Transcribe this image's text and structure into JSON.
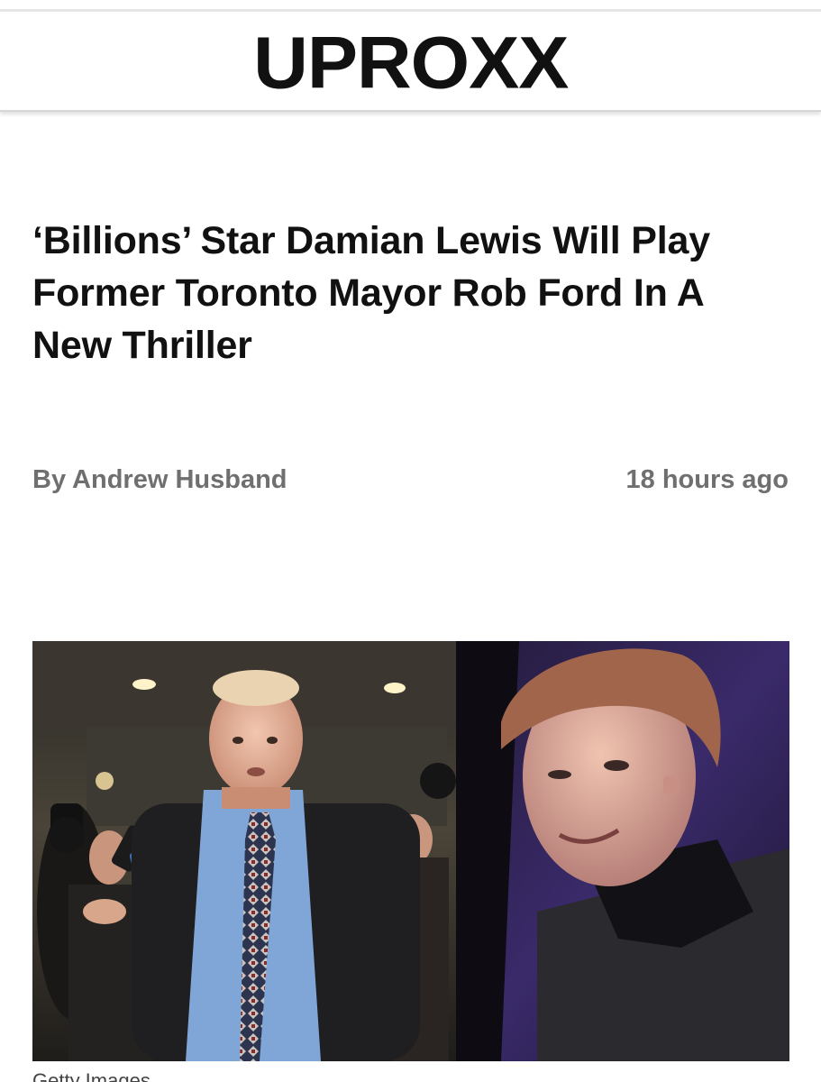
{
  "header": {
    "logo_text": "UPROXX"
  },
  "article": {
    "headline": "‘Billions’ Star Damian Lewis Will Play Former Toronto Mayor Rob Ford In A New Thriller",
    "author": "By Andrew Husband",
    "timestamp": "18 hours ago",
    "caption_partial": "Getty Images"
  },
  "colors": {
    "logo": "#111111",
    "headline": "#111111",
    "byline": "#6f6f6f",
    "header_border": "#d6d6d6"
  }
}
